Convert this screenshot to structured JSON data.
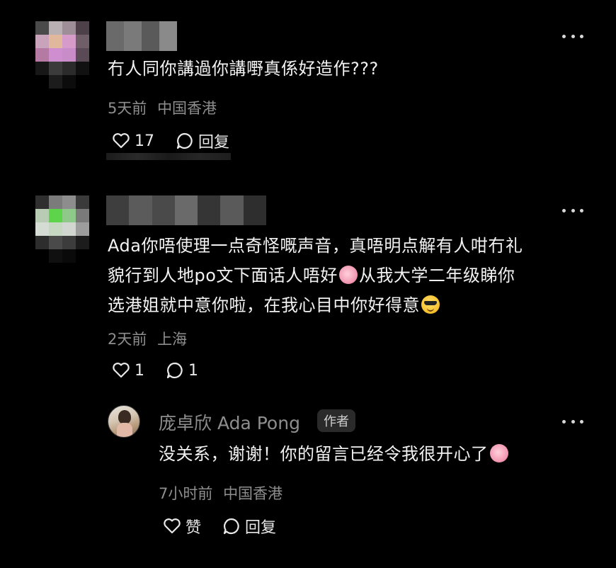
{
  "comments": [
    {
      "text": "冇人同你講過你講嘢真係好造作???",
      "time": "5天前",
      "location": "中国香港",
      "like_count": "17",
      "reply_label": "回复"
    },
    {
      "text_line1": "Ada你唔使理一点奇怪嘅声音，真唔明点解有人咁冇礼",
      "text_line2a": "貌行到人地po文下面话人唔好",
      "text_line2b": "从我大学二年级睇你",
      "text_line3": "选港姐就中意你啦，在我心目中你好得意",
      "time": "2天前",
      "location": "上海",
      "like_count": "1",
      "reply_count": "1"
    }
  ],
  "reply": {
    "author": "庞卓欣 Ada Pong",
    "badge": "作者",
    "text": "没关系，谢谢！你的留言已经令我很开心了",
    "time": "7小时前",
    "location": "中国香港",
    "like_label": "赞",
    "reply_label": "回复"
  },
  "icons": [
    "more-icon",
    "heart-icon",
    "comment-bubble-icon",
    "pink-emoji-icon",
    "sunglasses-emoji-icon"
  ]
}
